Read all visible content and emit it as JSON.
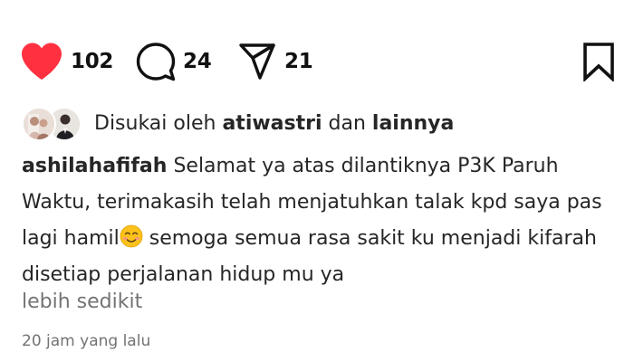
{
  "actions": {
    "like_count": "102",
    "comment_count": "24",
    "share_count": "21",
    "like_icon": "heart-filled-icon",
    "comment_icon": "speech-bubble-icon",
    "share_icon": "paper-plane-icon",
    "save_icon": "bookmark-icon",
    "like_color": "#ff3040"
  },
  "likes": {
    "prefix": "Disukai oleh",
    "user": "atiwastri",
    "connector": "dan",
    "others": "lainnya"
  },
  "caption": {
    "username": "ashilahafifah",
    "text_before_emoji": "Selamat ya atas dilantiknya P3K Paruh Waktu, terimakasih telah menjatuhkan talak kpd saya pas lagi hamil",
    "emoji": "☺️",
    "text_after_emoji": " semoga semua rasa sakit ku menjadi kifarah disetiap perjalanan hidup mu ya",
    "more_label": "lebih sedikit"
  },
  "timestamp": "20 jam yang lalu"
}
